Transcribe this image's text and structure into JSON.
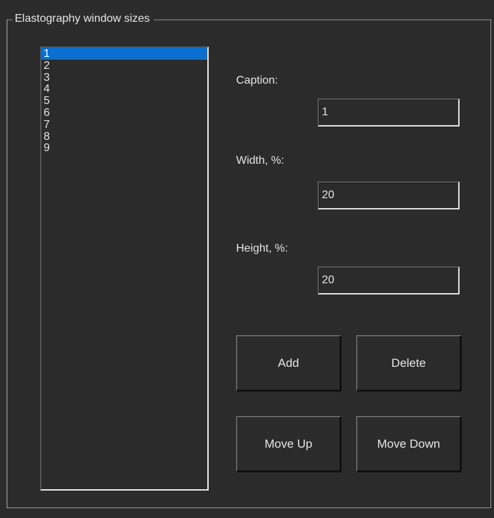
{
  "group": {
    "title": "Elastography window sizes"
  },
  "list": {
    "items": [
      "1",
      "2",
      "3",
      "4",
      "5",
      "6",
      "7",
      "8",
      "9"
    ],
    "selected": "1"
  },
  "form": {
    "caption_label": "Caption:",
    "caption_value": "1",
    "width_label": "Width, %:",
    "width_value": "20",
    "height_label": "Height, %:",
    "height_value": "20"
  },
  "buttons": {
    "add": "Add",
    "delete": "Delete",
    "move_up": "Move Up",
    "move_down": "Move Down"
  },
  "colors": {
    "background": "#2b2b2b",
    "selection": "#0a6fd0",
    "text": "#e6e6e6"
  }
}
